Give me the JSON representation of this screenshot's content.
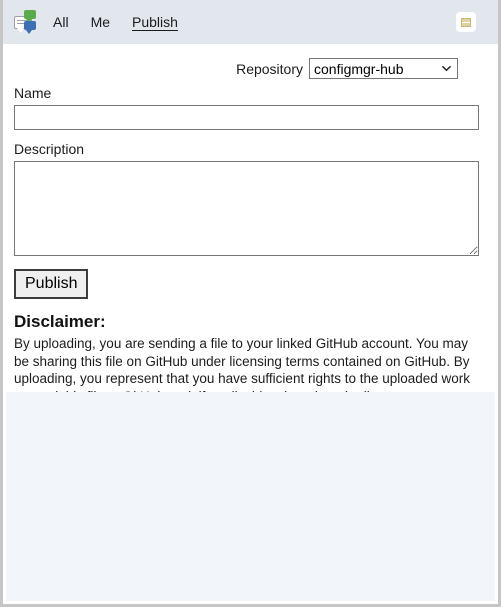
{
  "window": {
    "title": "Publish",
    "border_color": "#c6c6c6",
    "background": "#ffffff"
  },
  "toolbar": {
    "background": "#e2e7ee",
    "app_icon": "comments-icon",
    "nav_items": [
      {
        "label": "All",
        "active": false
      },
      {
        "label": "Me",
        "active": false
      },
      {
        "label": "Publish",
        "active": true
      }
    ],
    "right_button": {
      "icon": "notes-icon",
      "background": "#ffffff",
      "glyph_color": "#ddd2a0"
    }
  },
  "form": {
    "repository": {
      "label": "Repository",
      "selected": "configmgr-hub",
      "options": [
        "configmgr-hub"
      ]
    },
    "name": {
      "label": "Name",
      "value": "",
      "placeholder": ""
    },
    "description": {
      "label": "Description",
      "value": "",
      "placeholder": ""
    },
    "publish_button": {
      "label": "Publish"
    }
  },
  "disclaimer": {
    "title": "Disclaimer:",
    "text": "By uploading, you are sending a file to your linked GitHub account. You may be sharing this file on GitHub under licensing terms contained on GitHub. By uploading, you represent that you have sufficient rights to the uploaded work to send this file to GitHub and, if applicable, share it under license terms contained on GitHub."
  },
  "footer": {
    "background": "#f2f5fa"
  }
}
